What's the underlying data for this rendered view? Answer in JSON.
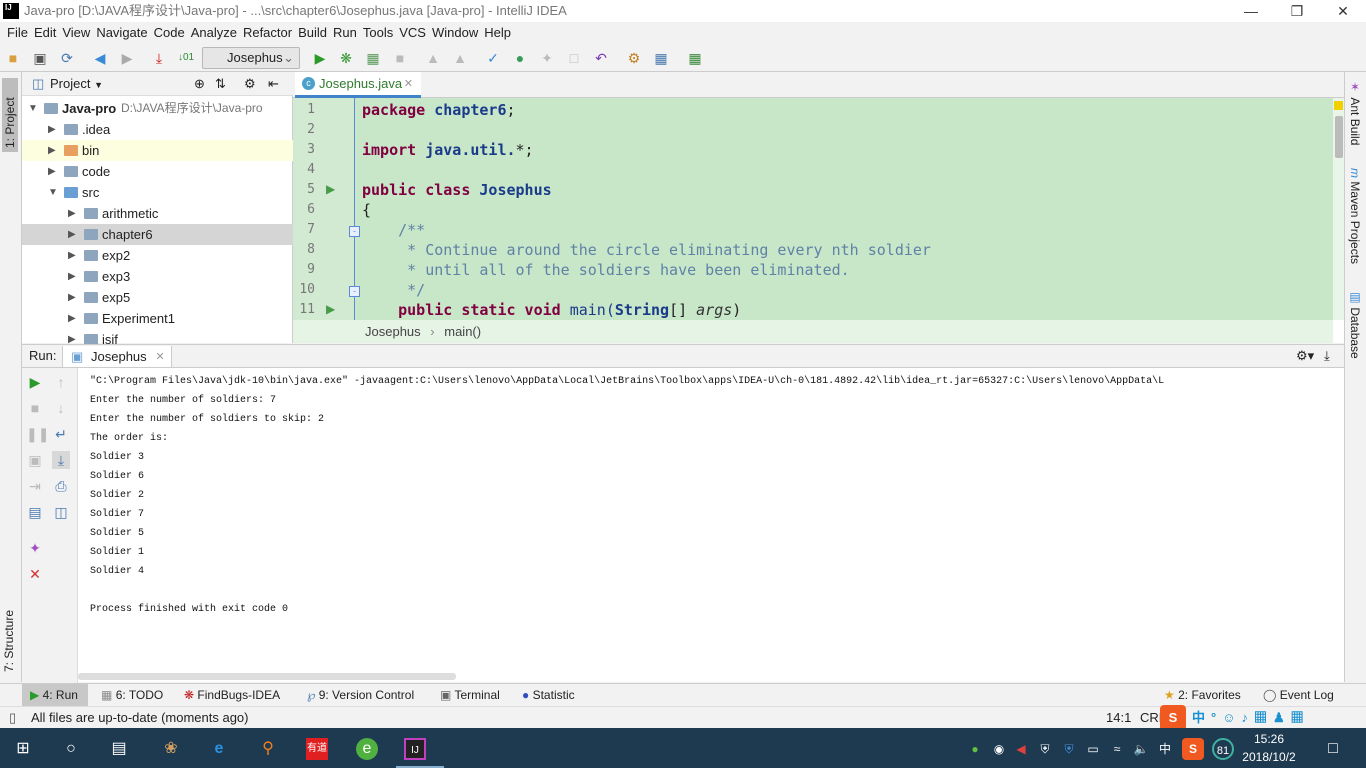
{
  "window": {
    "title": "Java-pro [D:\\JAVA程序设计\\Java-pro] - ...\\src\\chapter6\\Josephus.java [Java-pro] - IntelliJ IDEA",
    "logo": "IJ"
  },
  "menu": [
    "File",
    "Edit",
    "View",
    "Navigate",
    "Code",
    "Analyze",
    "Refactor",
    "Build",
    "Run",
    "Tools",
    "VCS",
    "Window",
    "Help"
  ],
  "toolbar": {
    "run_config": "Josephus"
  },
  "left_strip": {
    "project_tab": "1: Project",
    "structure_tab": "7: Structure"
  },
  "right_strip": {
    "ant": "Ant Build",
    "maven": "Maven Projects",
    "database": "Database"
  },
  "project": {
    "title": "Project",
    "root": {
      "name": "Java-pro",
      "path": "D:\\JAVA程序设计\\Java-pro"
    },
    "items": [
      {
        "label": ".idea",
        "level": 1,
        "expanded": false
      },
      {
        "label": "bin",
        "level": 1,
        "expanded": false,
        "color": "#e8a060"
      },
      {
        "label": "code",
        "level": 1,
        "expanded": false
      },
      {
        "label": "src",
        "level": 1,
        "expanded": true,
        "color": "#6a9fd4"
      },
      {
        "label": "arithmetic",
        "level": 2,
        "expanded": false
      },
      {
        "label": "chapter6",
        "level": 2,
        "expanded": false,
        "selected": true
      },
      {
        "label": "exp2",
        "level": 2,
        "expanded": false
      },
      {
        "label": "exp3",
        "level": 2,
        "expanded": false
      },
      {
        "label": "exp5",
        "level": 2,
        "expanded": false
      },
      {
        "label": "Experiment1",
        "level": 2,
        "expanded": false
      },
      {
        "label": "jsjf",
        "level": 2,
        "expanded": false
      }
    ]
  },
  "editor": {
    "tab": "Josephus.java",
    "lines": [
      "1",
      "2",
      "3",
      "4",
      "5",
      "6",
      "7",
      "8",
      "9",
      "10",
      "11"
    ],
    "code": {
      "l1a": "package ",
      "l1b": "chapter6",
      ";": ";",
      "l3a": "import ",
      "l3b": "java.util.",
      "l3c": "*;",
      "l5a": "public class ",
      "l5b": "Josephus",
      "l6": "{",
      "l7": "    /**",
      "l8": "     * Continue around the circle eliminating every nth soldier",
      "l9": "     * until all of the soldiers have been eliminated.",
      "l10": "     */",
      "l11a": "    public static void ",
      "l11b": "main(",
      "l11c": "String",
      "l11d": "[] ",
      "l11e": "args",
      ")": ")"
    },
    "breadcrumb": [
      "Josephus",
      "main()"
    ]
  },
  "run": {
    "label": "Run:",
    "tab": "Josephus",
    "output": [
      "\"C:\\Program Files\\Java\\jdk-10\\bin\\java.exe\" -javaagent:C:\\Users\\lenovo\\AppData\\Local\\JetBrains\\Toolbox\\apps\\IDEA-U\\ch-0\\181.4892.42\\lib\\idea_rt.jar=65327:C:\\Users\\lenovo\\AppData\\L",
      "Enter the number of soldiers: 7",
      "Enter the number of soldiers to skip: 2",
      "The order is:",
      "Soldier 3",
      "Soldier 6",
      "Soldier 2",
      "Soldier 7",
      "Soldier 5",
      "Soldier 1",
      "Soldier 4",
      "",
      "Process finished with exit code 0"
    ]
  },
  "bottom_tabs": [
    "4: Run",
    "6: TODO",
    "FindBugs-IDEA",
    "9: Version Control",
    "Terminal",
    "Statistic"
  ],
  "bottom_right": [
    "2: Favorites",
    "Event Log"
  ],
  "status": {
    "message": "All files are up-to-date (moments ago)",
    "position": "14:1",
    "line_sep": "CRL"
  },
  "taskbar": {
    "time": "15:26",
    "date": "2018/10/2",
    "ime": "中",
    "battery_badge": "81",
    "youdao": "有道"
  }
}
